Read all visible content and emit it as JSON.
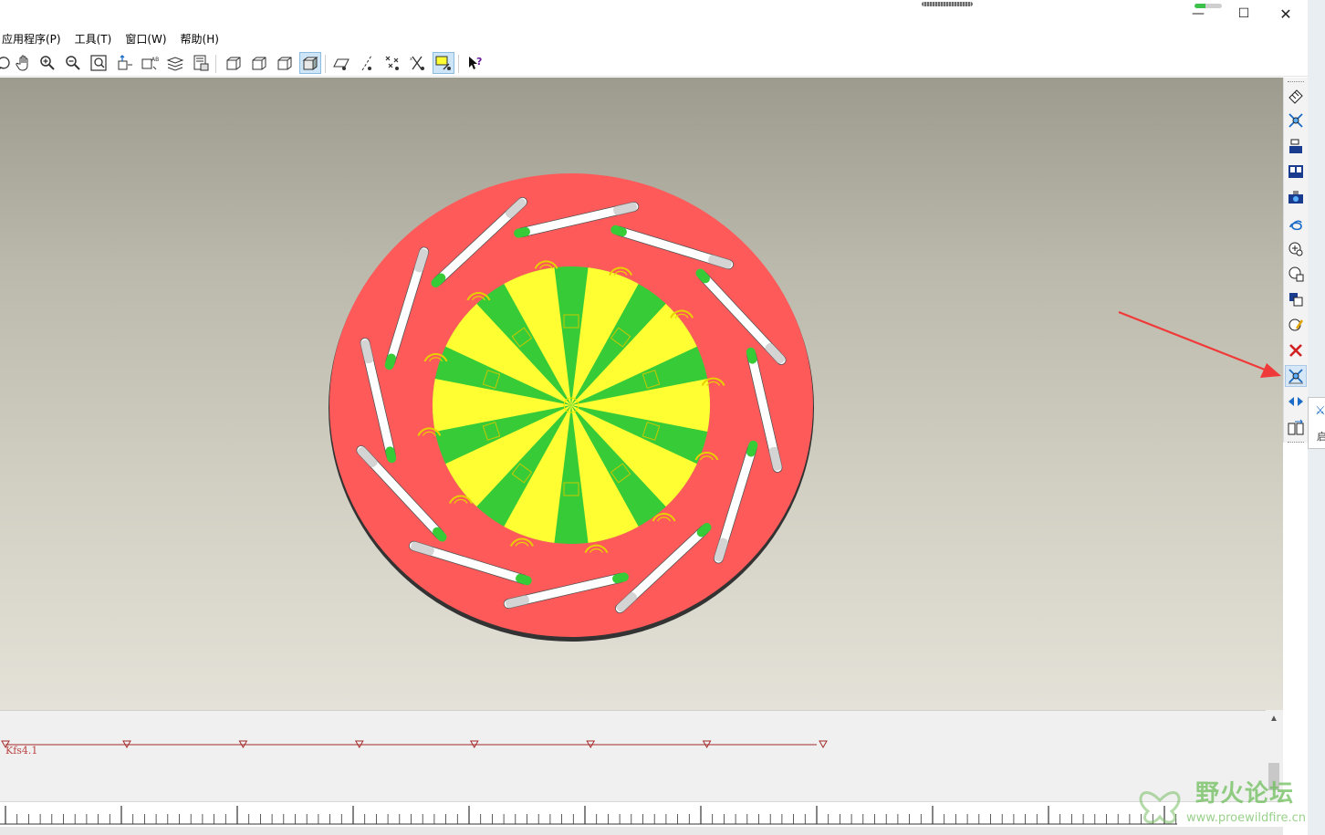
{
  "window": {
    "min_glyph": "—",
    "max_glyph": "☐",
    "close_glyph": "✕"
  },
  "menu": {
    "items": [
      {
        "label": "应用程序(P)"
      },
      {
        "label": "工具(T)"
      },
      {
        "label": "窗口(W)"
      },
      {
        "label": "帮助(H)"
      }
    ]
  },
  "toolbar": {
    "icons": [
      "spin-icon",
      "pan-icon",
      "zoom-in-icon",
      "zoom-out-icon",
      "refit-icon",
      "reorient-icon",
      "saved-views-icon",
      "layers-icon",
      "view-manager-icon",
      "shading-icon",
      "hidden-line-icon",
      "no-hidden-icon",
      "shaded-icon",
      "datum-planes-icon",
      "datum-axes-icon",
      "datum-points-icon",
      "coordinate-systems-icon",
      "annotation-display-icon",
      "whats-this-help-icon"
    ],
    "active": [
      "shaded-icon",
      "annotation-display-icon"
    ]
  },
  "right_toolbar": {
    "icons": [
      "connection-icon",
      "servo-motor-icon",
      "mechanism-settings-icon",
      "drag-components-icon",
      "snapshot-icon",
      "spring-icon",
      "damper-icon",
      "force-torque-icon",
      "gravity-icon",
      "analysis-definition-icon",
      "delete-icon",
      "motor-playback-icon",
      "playback-icon",
      "measure-results-icon"
    ]
  },
  "right_popup": {
    "text": "启"
  },
  "timeline": {
    "label": "Kfs4.1",
    "keyframe_positions_pct": [
      0,
      9.5,
      18.6,
      27.7,
      36.7,
      45.8,
      54.9,
      64.0
    ],
    "line_color": "#a52a2a"
  },
  "watermark": {
    "name": "野火论坛",
    "url": "www.proewildfire.cn"
  },
  "colors": {
    "disc": "#fe5a5a",
    "disc_rim": "#333333",
    "green": "#37cb37",
    "yellow": "#fefe32",
    "slot": "#ffffff",
    "arrow": "#f03a3a",
    "viewport_top": "#9d9b8e",
    "viewport_bottom": "#e4e2d8"
  }
}
